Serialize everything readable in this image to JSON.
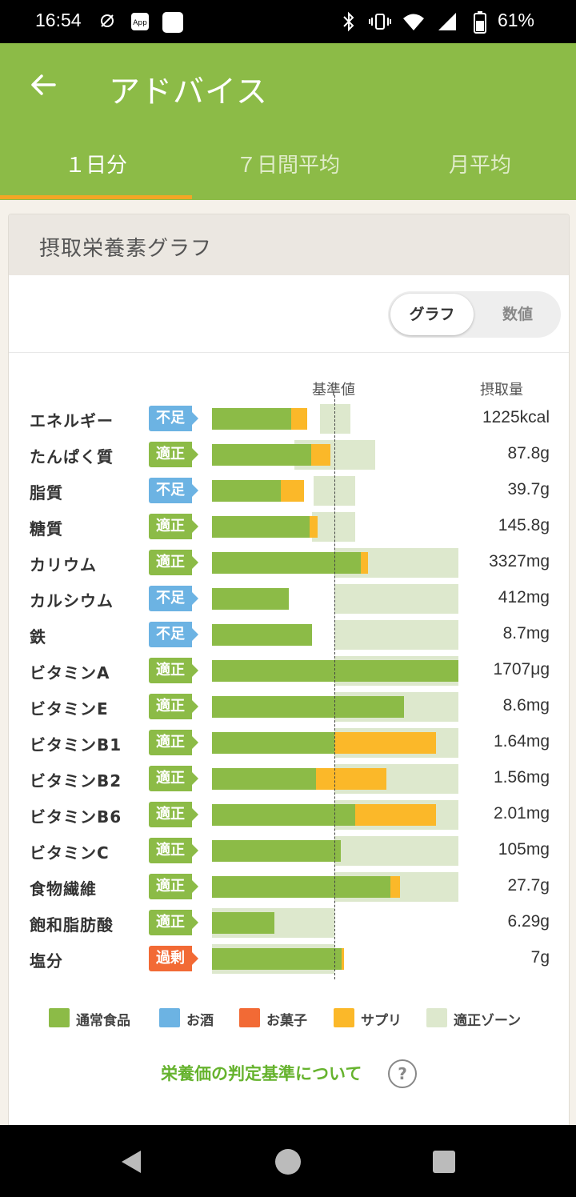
{
  "status": {
    "time": "16:54",
    "battery": "61%"
  },
  "appbar": {
    "title": "アドバイス"
  },
  "tabs": [
    {
      "label": "１日分"
    },
    {
      "label": "７日間平均"
    },
    {
      "label": "月平均"
    }
  ],
  "card": {
    "title": "摂取栄養素グラフ"
  },
  "toggle": {
    "graph": "グラフ",
    "numeric": "数値"
  },
  "headers": {
    "reference": "基準値",
    "intake": "摂取量"
  },
  "colors": {
    "food": "#8cbb47",
    "alcohol": "#6cb3e3",
    "sweets": "#f26a35",
    "supplement": "#fbb829",
    "zone": "#dde8cd",
    "badge_short": "#6cb3e3",
    "badge_ok": "#8cbb47",
    "badge_over": "#f26a35"
  },
  "rows": [
    {
      "name": "エネルギー",
      "status": "不足",
      "kind": "short",
      "value": "1225kcal"
    },
    {
      "name": "たんぱく質",
      "status": "適正",
      "kind": "ok",
      "value": "87.8g"
    },
    {
      "name": "脂質",
      "status": "不足",
      "kind": "short",
      "value": "39.7g"
    },
    {
      "name": "糖質",
      "status": "適正",
      "kind": "ok",
      "value": "145.8g"
    },
    {
      "name": "カリウム",
      "status": "適正",
      "kind": "ok",
      "value": "3327mg"
    },
    {
      "name": "カルシウム",
      "status": "不足",
      "kind": "short",
      "value": "412mg"
    },
    {
      "name": "鉄",
      "status": "不足",
      "kind": "short",
      "value": "8.7mg"
    },
    {
      "name": "ビタミンA",
      "status": "適正",
      "kind": "ok",
      "value": "1707μg"
    },
    {
      "name": "ビタミンE",
      "status": "適正",
      "kind": "ok",
      "value": "8.6mg"
    },
    {
      "name": "ビタミンB1",
      "status": "適正",
      "kind": "ok",
      "value": "1.64mg"
    },
    {
      "name": "ビタミンB2",
      "status": "適正",
      "kind": "ok",
      "value": "1.56mg"
    },
    {
      "name": "ビタミンB6",
      "status": "適正",
      "kind": "ok",
      "value": "2.01mg"
    },
    {
      "name": "ビタミンC",
      "status": "適正",
      "kind": "ok",
      "value": "105mg"
    },
    {
      "name": "食物繊維",
      "status": "適正",
      "kind": "ok",
      "value": "27.7g"
    },
    {
      "name": "飽和脂肪酸",
      "status": "適正",
      "kind": "ok",
      "value": "6.29g"
    },
    {
      "name": "塩分",
      "status": "過剰",
      "kind": "over",
      "value": "7g"
    }
  ],
  "chart_data": {
    "type": "bar",
    "orientation": "horizontal",
    "stacked": true,
    "value_unit": "fraction of reference value (1.0 = 基準値)",
    "categories": [
      "エネルギー",
      "たんぱく質",
      "脂質",
      "糖質",
      "カリウム",
      "カルシウム",
      "鉄",
      "ビタミンA",
      "ビタミンE",
      "ビタミンB1",
      "ビタミンB2",
      "ビタミンB6",
      "ビタミンC",
      "食物繊維",
      "飽和脂肪酸",
      "塩分"
    ],
    "series": [
      {
        "name": "通常食品",
        "color": "#8cbb47",
        "values": [
          0.65,
          0.81,
          0.56,
          0.8,
          1.21,
          0.63,
          0.82,
          2.0,
          1.56,
          1.0,
          0.85,
          1.17,
          1.05,
          1.45,
          0.51,
          1.06
        ]
      },
      {
        "name": "サプリ",
        "color": "#fbb829",
        "values": [
          0.13,
          0.16,
          0.19,
          0.06,
          0.06,
          0,
          0,
          0,
          0,
          0.82,
          0.57,
          0.65,
          0,
          0.08,
          0,
          0.02
        ]
      }
    ],
    "zones": [
      [
        0.88,
        1.13
      ],
      [
        0.67,
        1.33
      ],
      [
        0.83,
        1.17
      ],
      [
        0.82,
        1.17
      ],
      [
        1.0,
        2.0
      ],
      [
        1.0,
        2.0
      ],
      [
        1.0,
        2.0
      ],
      [
        1.0,
        2.0
      ],
      [
        1.0,
        2.0
      ],
      [
        1.0,
        2.0
      ],
      [
        1.0,
        2.0
      ],
      [
        1.0,
        2.0
      ],
      [
        1.0,
        2.0
      ],
      [
        1.0,
        2.0
      ],
      [
        0,
        1.0
      ],
      [
        0,
        1.0
      ]
    ],
    "reference_line": 1.0,
    "xlim": [
      0,
      2.0
    ],
    "legend": [
      "通常食品",
      "お酒",
      "お菓子",
      "サプリ",
      "適正ゾーン"
    ],
    "legend_position": "bottom"
  },
  "link": {
    "label": "栄養価の判定基準について",
    "help": "?"
  }
}
